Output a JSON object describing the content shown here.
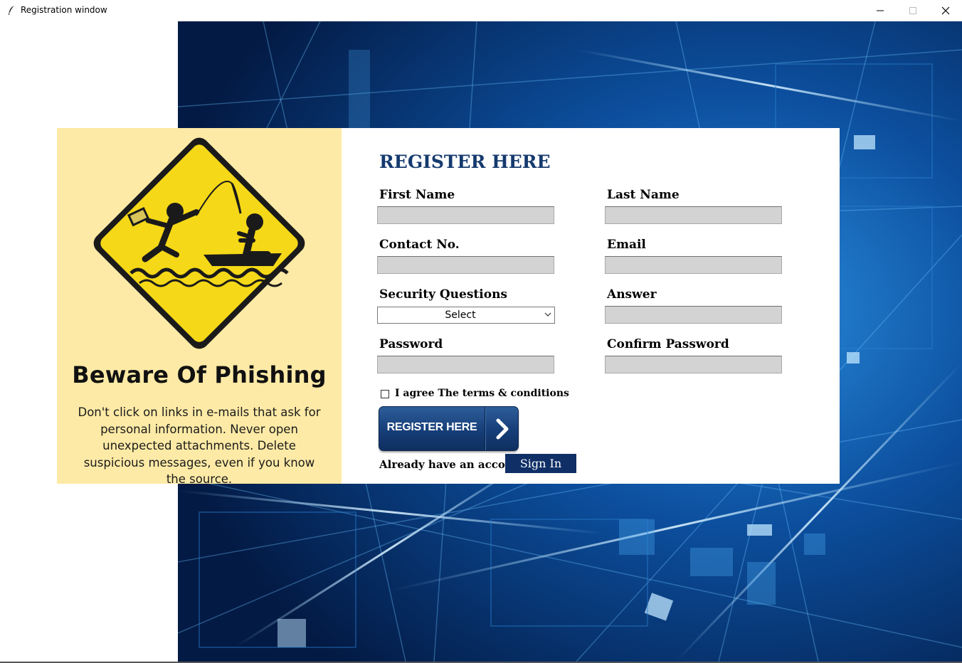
{
  "window": {
    "title": "Registration window",
    "icon": "feather-icon",
    "controls": [
      "minimize-icon",
      "maximize-icon",
      "close-icon"
    ]
  },
  "phishing_panel": {
    "heading": "Beware Of Phishing",
    "body": "Don't click on links in e-mails that ask for personal information. Never open unexpected attachments. Delete suspicious messages, even if you know the source.",
    "sign_icon": "phishing-warning-sign",
    "background_color": "#fdeaa6"
  },
  "form": {
    "heading": "REGISTER HERE",
    "fields": {
      "first_name": {
        "label": "First Name",
        "value": ""
      },
      "last_name": {
        "label": "Last Name",
        "value": ""
      },
      "contact": {
        "label": "Contact No.",
        "value": ""
      },
      "email": {
        "label": "Email",
        "value": ""
      },
      "security_question": {
        "label": "Security Questions",
        "value": "Select"
      },
      "answer": {
        "label": "Answer",
        "value": ""
      },
      "password": {
        "label": "Password",
        "value": ""
      },
      "confirm_password": {
        "label": "Confirm Password",
        "value": ""
      }
    },
    "terms": {
      "label": "I agree The terms & conditions",
      "checked": false
    },
    "register_button": "REGISTER HERE",
    "already_text": "Already have an account?",
    "sign_in_button": "Sign In",
    "colors": {
      "heading": "#153a6e",
      "sign_in_bg": "#0f2f66",
      "input_bg": "#d3d3d3"
    }
  }
}
